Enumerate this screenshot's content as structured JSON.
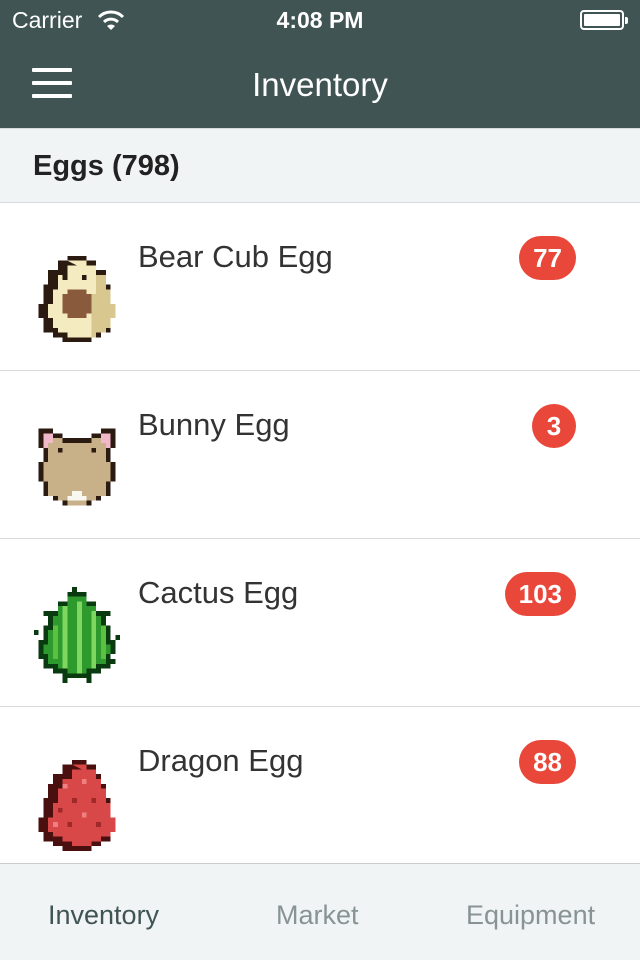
{
  "status_bar": {
    "carrier": "Carrier",
    "time": "4:08 PM"
  },
  "nav": {
    "title": "Inventory"
  },
  "section": {
    "title": "Eggs (798)"
  },
  "items": [
    {
      "name": "Bear Cub Egg",
      "count": "77",
      "icon": "bear-cub-egg-icon"
    },
    {
      "name": "Bunny Egg",
      "count": "3",
      "icon": "bunny-egg-icon"
    },
    {
      "name": "Cactus Egg",
      "count": "103",
      "icon": "cactus-egg-icon"
    },
    {
      "name": "Dragon Egg",
      "count": "88",
      "icon": "dragon-egg-icon"
    }
  ],
  "tabs": [
    {
      "label": "Inventory",
      "active": true
    },
    {
      "label": "Market",
      "active": false
    },
    {
      "label": "Equipment",
      "active": false
    }
  ],
  "colors": {
    "nav_bg": "#3f5453",
    "badge": "#e8473a",
    "tab_inactive": "#889494"
  }
}
